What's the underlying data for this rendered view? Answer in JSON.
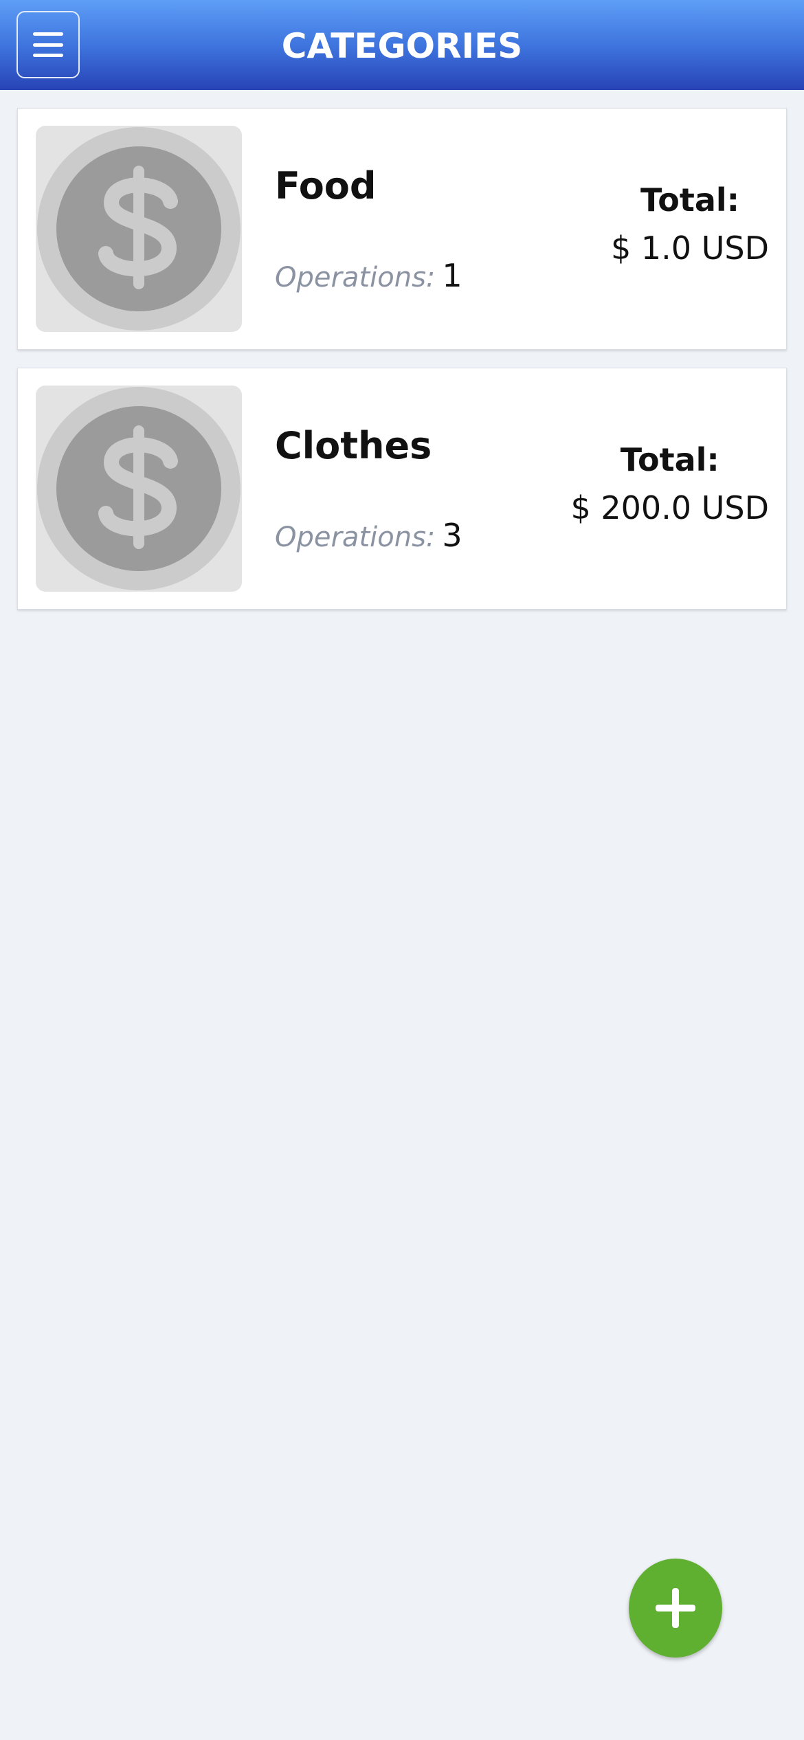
{
  "header": {
    "title": "CATEGORIES",
    "menu_icon": "hamburger-menu-icon"
  },
  "categories": [
    {
      "name": "Food",
      "operations_label": "Operations:",
      "operations_count": "1",
      "total_label": "Total:",
      "total_amount": "$ 1.0 USD",
      "icon": "dollar-coin-icon"
    },
    {
      "name": "Clothes",
      "operations_label": "Operations:",
      "operations_count": "3",
      "total_label": "Total:",
      "total_amount": "$ 200.0 USD",
      "icon": "dollar-coin-icon"
    }
  ],
  "fab": {
    "icon": "plus-icon",
    "color": "#5fb030"
  },
  "colors": {
    "header_top": "#5e9ef7",
    "header_bottom": "#2743b6",
    "background": "#eff2f7",
    "muted_text": "#8b93a2"
  }
}
